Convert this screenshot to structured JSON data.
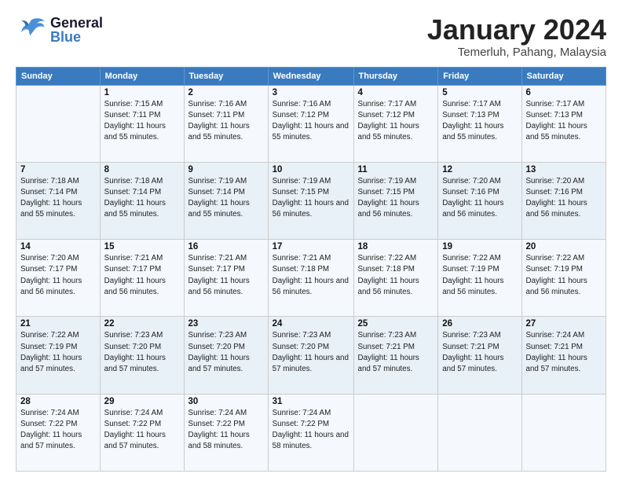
{
  "header": {
    "logo_general": "General",
    "logo_blue": "Blue",
    "month_year": "January 2024",
    "location": "Temerluh, Pahang, Malaysia"
  },
  "calendar": {
    "days_of_week": [
      "Sunday",
      "Monday",
      "Tuesday",
      "Wednesday",
      "Thursday",
      "Friday",
      "Saturday"
    ],
    "weeks": [
      [
        {
          "num": "",
          "sunrise": "",
          "sunset": "",
          "daylight": ""
        },
        {
          "num": "1",
          "sunrise": "Sunrise: 7:15 AM",
          "sunset": "Sunset: 7:11 PM",
          "daylight": "Daylight: 11 hours and 55 minutes."
        },
        {
          "num": "2",
          "sunrise": "Sunrise: 7:16 AM",
          "sunset": "Sunset: 7:11 PM",
          "daylight": "Daylight: 11 hours and 55 minutes."
        },
        {
          "num": "3",
          "sunrise": "Sunrise: 7:16 AM",
          "sunset": "Sunset: 7:12 PM",
          "daylight": "Daylight: 11 hours and 55 minutes."
        },
        {
          "num": "4",
          "sunrise": "Sunrise: 7:17 AM",
          "sunset": "Sunset: 7:12 PM",
          "daylight": "Daylight: 11 hours and 55 minutes."
        },
        {
          "num": "5",
          "sunrise": "Sunrise: 7:17 AM",
          "sunset": "Sunset: 7:13 PM",
          "daylight": "Daylight: 11 hours and 55 minutes."
        },
        {
          "num": "6",
          "sunrise": "Sunrise: 7:17 AM",
          "sunset": "Sunset: 7:13 PM",
          "daylight": "Daylight: 11 hours and 55 minutes."
        }
      ],
      [
        {
          "num": "7",
          "sunrise": "Sunrise: 7:18 AM",
          "sunset": "Sunset: 7:14 PM",
          "daylight": "Daylight: 11 hours and 55 minutes."
        },
        {
          "num": "8",
          "sunrise": "Sunrise: 7:18 AM",
          "sunset": "Sunset: 7:14 PM",
          "daylight": "Daylight: 11 hours and 55 minutes."
        },
        {
          "num": "9",
          "sunrise": "Sunrise: 7:19 AM",
          "sunset": "Sunset: 7:14 PM",
          "daylight": "Daylight: 11 hours and 55 minutes."
        },
        {
          "num": "10",
          "sunrise": "Sunrise: 7:19 AM",
          "sunset": "Sunset: 7:15 PM",
          "daylight": "Daylight: 11 hours and 56 minutes."
        },
        {
          "num": "11",
          "sunrise": "Sunrise: 7:19 AM",
          "sunset": "Sunset: 7:15 PM",
          "daylight": "Daylight: 11 hours and 56 minutes."
        },
        {
          "num": "12",
          "sunrise": "Sunrise: 7:20 AM",
          "sunset": "Sunset: 7:16 PM",
          "daylight": "Daylight: 11 hours and 56 minutes."
        },
        {
          "num": "13",
          "sunrise": "Sunrise: 7:20 AM",
          "sunset": "Sunset: 7:16 PM",
          "daylight": "Daylight: 11 hours and 56 minutes."
        }
      ],
      [
        {
          "num": "14",
          "sunrise": "Sunrise: 7:20 AM",
          "sunset": "Sunset: 7:17 PM",
          "daylight": "Daylight: 11 hours and 56 minutes."
        },
        {
          "num": "15",
          "sunrise": "Sunrise: 7:21 AM",
          "sunset": "Sunset: 7:17 PM",
          "daylight": "Daylight: 11 hours and 56 minutes."
        },
        {
          "num": "16",
          "sunrise": "Sunrise: 7:21 AM",
          "sunset": "Sunset: 7:17 PM",
          "daylight": "Daylight: 11 hours and 56 minutes."
        },
        {
          "num": "17",
          "sunrise": "Sunrise: 7:21 AM",
          "sunset": "Sunset: 7:18 PM",
          "daylight": "Daylight: 11 hours and 56 minutes."
        },
        {
          "num": "18",
          "sunrise": "Sunrise: 7:22 AM",
          "sunset": "Sunset: 7:18 PM",
          "daylight": "Daylight: 11 hours and 56 minutes."
        },
        {
          "num": "19",
          "sunrise": "Sunrise: 7:22 AM",
          "sunset": "Sunset: 7:19 PM",
          "daylight": "Daylight: 11 hours and 56 minutes."
        },
        {
          "num": "20",
          "sunrise": "Sunrise: 7:22 AM",
          "sunset": "Sunset: 7:19 PM",
          "daylight": "Daylight: 11 hours and 56 minutes."
        }
      ],
      [
        {
          "num": "21",
          "sunrise": "Sunrise: 7:22 AM",
          "sunset": "Sunset: 7:19 PM",
          "daylight": "Daylight: 11 hours and 57 minutes."
        },
        {
          "num": "22",
          "sunrise": "Sunrise: 7:23 AM",
          "sunset": "Sunset: 7:20 PM",
          "daylight": "Daylight: 11 hours and 57 minutes."
        },
        {
          "num": "23",
          "sunrise": "Sunrise: 7:23 AM",
          "sunset": "Sunset: 7:20 PM",
          "daylight": "Daylight: 11 hours and 57 minutes."
        },
        {
          "num": "24",
          "sunrise": "Sunrise: 7:23 AM",
          "sunset": "Sunset: 7:20 PM",
          "daylight": "Daylight: 11 hours and 57 minutes."
        },
        {
          "num": "25",
          "sunrise": "Sunrise: 7:23 AM",
          "sunset": "Sunset: 7:21 PM",
          "daylight": "Daylight: 11 hours and 57 minutes."
        },
        {
          "num": "26",
          "sunrise": "Sunrise: 7:23 AM",
          "sunset": "Sunset: 7:21 PM",
          "daylight": "Daylight: 11 hours and 57 minutes."
        },
        {
          "num": "27",
          "sunrise": "Sunrise: 7:24 AM",
          "sunset": "Sunset: 7:21 PM",
          "daylight": "Daylight: 11 hours and 57 minutes."
        }
      ],
      [
        {
          "num": "28",
          "sunrise": "Sunrise: 7:24 AM",
          "sunset": "Sunset: 7:22 PM",
          "daylight": "Daylight: 11 hours and 57 minutes."
        },
        {
          "num": "29",
          "sunrise": "Sunrise: 7:24 AM",
          "sunset": "Sunset: 7:22 PM",
          "daylight": "Daylight: 11 hours and 57 minutes."
        },
        {
          "num": "30",
          "sunrise": "Sunrise: 7:24 AM",
          "sunset": "Sunset: 7:22 PM",
          "daylight": "Daylight: 11 hours and 58 minutes."
        },
        {
          "num": "31",
          "sunrise": "Sunrise: 7:24 AM",
          "sunset": "Sunset: 7:22 PM",
          "daylight": "Daylight: 11 hours and 58 minutes."
        },
        {
          "num": "",
          "sunrise": "",
          "sunset": "",
          "daylight": ""
        },
        {
          "num": "",
          "sunrise": "",
          "sunset": "",
          "daylight": ""
        },
        {
          "num": "",
          "sunrise": "",
          "sunset": "",
          "daylight": ""
        }
      ]
    ]
  }
}
